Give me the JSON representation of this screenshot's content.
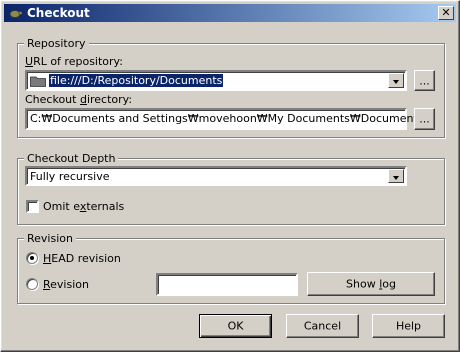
{
  "window": {
    "title": "Checkout",
    "close_glyph": "✕"
  },
  "repository": {
    "group_label": "Repository",
    "url_label_prefix": "",
    "url_label_underline": "U",
    "url_label_rest": "RL of repository:",
    "url_value": "file:///D:/Repository/Documents",
    "browse_url_label": "...",
    "dir_label_prefix": "Checkout ",
    "dir_label_underline": "d",
    "dir_label_rest": "irectory:",
    "dir_value": "C:₩Documents and Settings₩movehoon₩My Documents₩Documents",
    "browse_dir_label": "..."
  },
  "depth": {
    "group_label": "Checkout Depth",
    "selected": "Fully recursive",
    "omit_prefix": "Omit e",
    "omit_underline": "x",
    "omit_rest": "ternals",
    "omit_checked": false
  },
  "revision": {
    "group_label": "Revision",
    "head_underline": "H",
    "head_rest": "EAD revision",
    "head_checked": true,
    "rev_underline": "R",
    "rev_rest": "evision",
    "rev_value": "",
    "showlog_prefix": "Show ",
    "showlog_underline": "l",
    "showlog_rest": "og"
  },
  "buttons": {
    "ok": "OK",
    "cancel": "Cancel",
    "help": "Help"
  },
  "icons": {
    "app": "tortoise-icon",
    "folder": "folder-icon"
  }
}
